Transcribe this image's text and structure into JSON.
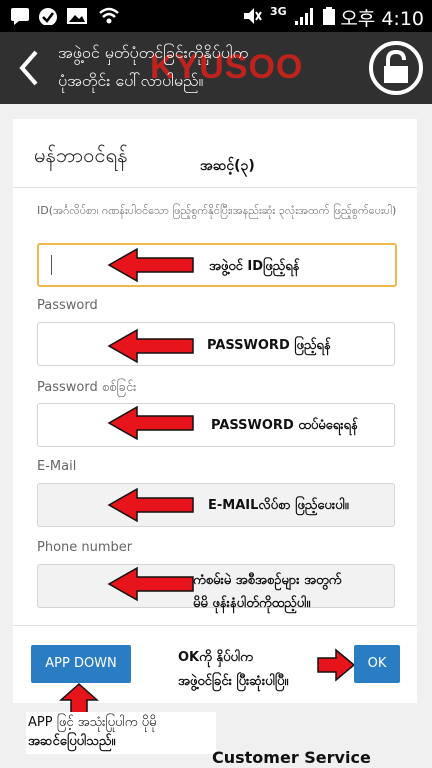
{
  "status_bar": {
    "time": "오후 4:10",
    "network": "3G",
    "left_icons": [
      "chat-icon",
      "check-circle-icon",
      "gallery-icon",
      "wifi-icon"
    ],
    "right_icons": [
      "mute-icon",
      "signal-icon",
      "battery-icon"
    ]
  },
  "header": {
    "title_line1": "အဖွဲ့ဝင် မှတ်ပုံတင်ခြင်းကိုနှိပ်ပါက",
    "title_line2": "ပုံအတိုင်း ပေါ်လာပါမည်။",
    "brand": "KYUSOO"
  },
  "form": {
    "title": "မန်ဘာဝင်ရန်",
    "step_note": "အဆင့်(၃)",
    "id_label": "ID(အင်္ဂလိပ်စာ၊ ဂဏန်းပါဝင်သော ဖြည့်စွက်နိုင်ပြီး၊အနည်းဆုံး ၃လုံးအထက် ဖြည့်စွက်ပေးပါ)",
    "id_hint": "အဖွဲ့ဝင် IDဖြည့်ရန်",
    "password_label": "Password",
    "password_hint": "PASSWORD ဖြည့်ရန်",
    "password_confirm_label": "Password စစ်ခြင်း",
    "password_confirm_hint": "PASSWORD ထပ်မံရေးရန်",
    "email_label": "E-Mail",
    "email_hint": "E-MAILလိပ်စာ ဖြည့်ပေးပါ။",
    "phone_label": "Phone number",
    "phone_hint_line1": "ကံစမ်းမဲ အစီအစဉ်များ အတွက်",
    "phone_hint_line2": "မိမိ ဖုန်းနံပါတ်ကိုထည့်ပါ။"
  },
  "buttons": {
    "app_down": "APP DOWN",
    "ok": "OK"
  },
  "ok_note_line1": "OKကို နှိပ်ပါက",
  "ok_note_line2": "အဖွဲ့ဝင်ခြင်း ပြီးဆုံးပါပြီ။",
  "bottom_note_line1": "APP ဖြင့် အသုံးပြုပါက ပိုမို",
  "bottom_note_line2": "အဆင်ပြေပါသည်။",
  "customer_service": "Customer Service",
  "colors": {
    "accent_blue": "#2b7dc3",
    "arrow_red": "#e8141c",
    "focus_border": "#f0b84a",
    "header_bg": "#303030"
  }
}
